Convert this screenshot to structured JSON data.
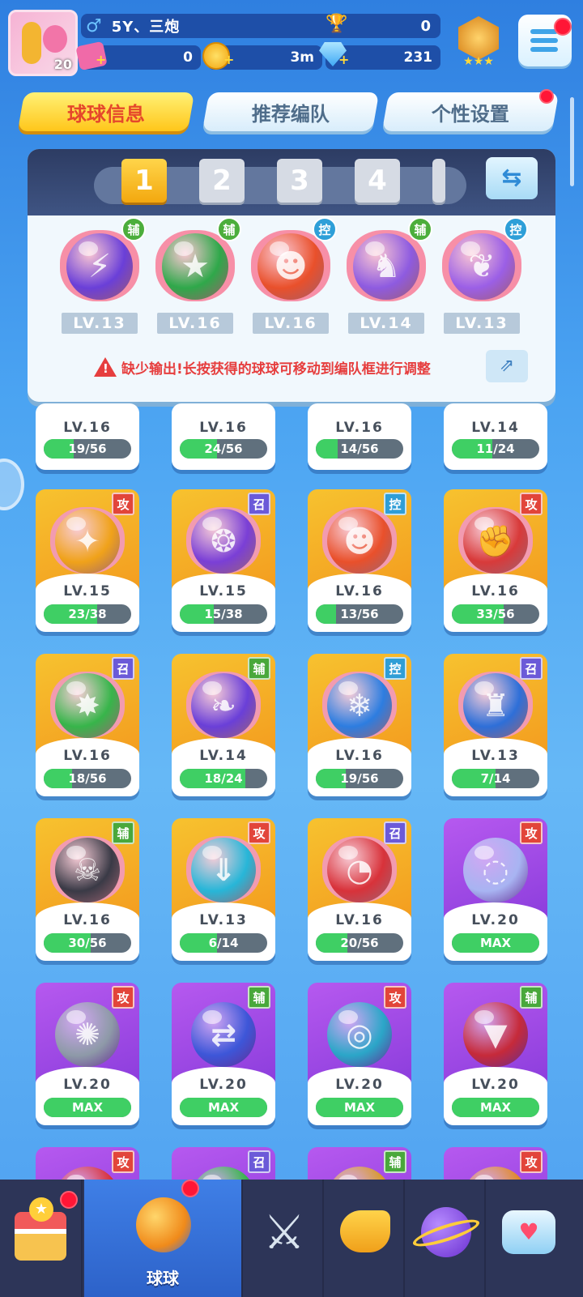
{
  "player": {
    "level": "20",
    "gender_icon": "male-icon",
    "name": "5Y、三炮",
    "trophies": "0",
    "tickets": "0",
    "coins": "3m",
    "gems": "231"
  },
  "tabs": [
    {
      "label": "球球信息",
      "active": true
    },
    {
      "label": "推荐编队",
      "active": false
    },
    {
      "label": "个性设置",
      "active": false,
      "badge": true
    }
  ],
  "team_slots": [
    "1",
    "2",
    "3",
    "4"
  ],
  "selected_slot": "1",
  "team": [
    {
      "role": "辅",
      "level": "LV.13",
      "color": "#6a3fd8",
      "glyph": "⚡"
    },
    {
      "role": "辅",
      "level": "LV.16",
      "color": "#2fa84a",
      "glyph": "★"
    },
    {
      "role": "控",
      "level": "LV.16",
      "color": "#e9502b",
      "glyph": "☻"
    },
    {
      "role": "辅",
      "level": "LV.14",
      "color": "#8e5be0",
      "glyph": "♞"
    },
    {
      "role": "控",
      "level": "LV.13",
      "color": "#9b5fe6",
      "glyph": "❦"
    }
  ],
  "warning": "缺少输出!长按获得的球球可移动到编队框进行调整",
  "top_partial_cards": [
    {
      "level": "LV.16",
      "progress": "19/56",
      "fill": 0.34
    },
    {
      "level": "LV.16",
      "progress": "24/56",
      "fill": 0.43
    },
    {
      "level": "LV.16",
      "progress": "14/56",
      "fill": 0.25
    },
    {
      "level": "LV.14",
      "progress": "11/24",
      "fill": 0.46
    }
  ],
  "cards": [
    {
      "role": "攻",
      "level": "LV.15",
      "progress": "23/38",
      "fill": 0.61,
      "tier": "gold",
      "color": "#f0a21a",
      "glyph": "✦"
    },
    {
      "role": "召",
      "level": "LV.15",
      "progress": "15/38",
      "fill": 0.39,
      "tier": "gold",
      "color": "#7a3fd6",
      "glyph": "❂"
    },
    {
      "role": "控",
      "level": "LV.16",
      "progress": "13/56",
      "fill": 0.23,
      "tier": "gold",
      "color": "#e9502b",
      "glyph": "☻"
    },
    {
      "role": "攻",
      "level": "LV.16",
      "progress": "33/56",
      "fill": 0.59,
      "tier": "gold",
      "color": "#d83a3a",
      "glyph": "✊"
    },
    {
      "role": "召",
      "level": "LV.16",
      "progress": "18/56",
      "fill": 0.32,
      "tier": "gold",
      "color": "#37b54a",
      "glyph": "✸"
    },
    {
      "role": "辅",
      "level": "LV.14",
      "progress": "18/24",
      "fill": 0.75,
      "tier": "gold",
      "color": "#6a3fd8",
      "glyph": "❧"
    },
    {
      "role": "控",
      "level": "LV.16",
      "progress": "19/56",
      "fill": 0.34,
      "tier": "gold",
      "color": "#2d7de0",
      "glyph": "❄"
    },
    {
      "role": "召",
      "level": "LV.13",
      "progress": "7/14",
      "fill": 0.5,
      "tier": "gold",
      "color": "#2e6fd8",
      "glyph": "♜"
    },
    {
      "role": "辅",
      "level": "LV.16",
      "progress": "30/56",
      "fill": 0.54,
      "tier": "gold",
      "color": "#3a3a46",
      "glyph": "☠"
    },
    {
      "role": "攻",
      "level": "LV.13",
      "progress": "6/14",
      "fill": 0.43,
      "tier": "gold",
      "color": "#27b6d8",
      "glyph": "⇓"
    },
    {
      "role": "召",
      "level": "LV.16",
      "progress": "20/56",
      "fill": 0.36,
      "tier": "gold",
      "color": "#d8323a",
      "glyph": "◔"
    },
    {
      "role": "攻",
      "level": "LV.20",
      "progress": "MAX",
      "fill": 1,
      "tier": "purple",
      "color": "#a8b4f2",
      "glyph": "◌"
    },
    {
      "role": "攻",
      "level": "LV.20",
      "progress": "MAX",
      "fill": 1,
      "tier": "purple",
      "color": "#8e9aa8",
      "glyph": "✺"
    },
    {
      "role": "辅",
      "level": "LV.20",
      "progress": "MAX",
      "fill": 1,
      "tier": "purple",
      "color": "#3d56d8",
      "glyph": "⇄"
    },
    {
      "role": "攻",
      "level": "LV.20",
      "progress": "MAX",
      "fill": 1,
      "tier": "purple",
      "color": "#2ba6c8",
      "glyph": "◎"
    },
    {
      "role": "辅",
      "level": "LV.20",
      "progress": "MAX",
      "fill": 1,
      "tier": "purple",
      "color": "#c62a3a",
      "glyph": "▼"
    },
    {
      "role": "攻",
      "level": "",
      "progress": "",
      "fill": 1,
      "tier": "purple",
      "color": "#d8323a",
      "glyph": ""
    },
    {
      "role": "召",
      "level": "",
      "progress": "",
      "fill": 1,
      "tier": "purple",
      "color": "#37b54a",
      "glyph": ""
    },
    {
      "role": "辅",
      "level": "",
      "progress": "",
      "fill": 1,
      "tier": "purple",
      "color": "#d89a2a",
      "glyph": ""
    },
    {
      "role": "攻",
      "level": "",
      "progress": "",
      "fill": 1,
      "tier": "purple",
      "color": "#e08a2a",
      "glyph": ""
    }
  ],
  "nav": [
    {
      "name": "shop-nav",
      "icon": "shop-icon",
      "label": "",
      "badge": true
    },
    {
      "name": "balls-nav",
      "icon": "balls-icon",
      "label": "球球",
      "badge": true,
      "active": true
    },
    {
      "name": "battle-nav",
      "icon": "crossed-swords-icon",
      "label": "",
      "badge": false
    },
    {
      "name": "whistle-nav",
      "icon": "whistle-icon",
      "label": "",
      "badge": false
    },
    {
      "name": "planet-nav",
      "icon": "planet-icon",
      "label": "",
      "badge": false
    },
    {
      "name": "social-nav",
      "icon": "chat-heart-icon",
      "label": "",
      "badge": false
    }
  ]
}
